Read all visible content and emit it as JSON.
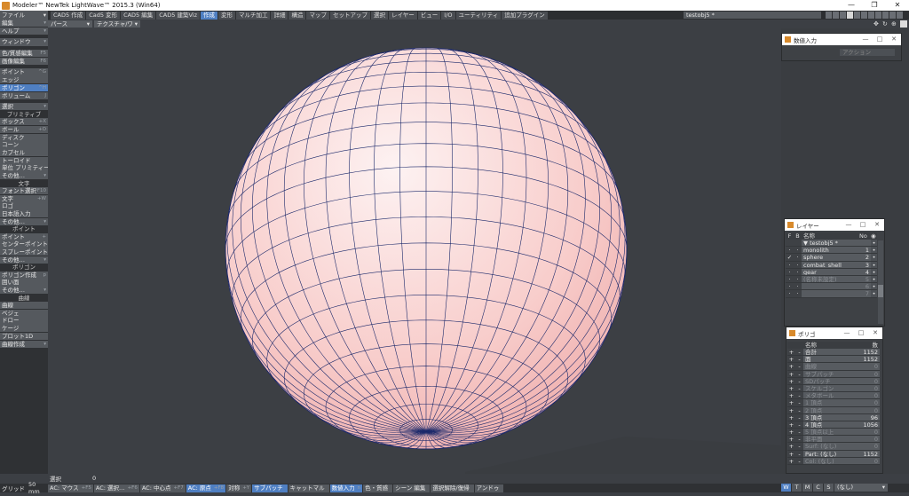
{
  "window": {
    "title": "Modeler™ NewTek LightWave™ 2015.3 (Win64)",
    "controls": [
      "—",
      "❐",
      "✕"
    ]
  },
  "menu": {
    "file": "ファイル",
    "tabs": [
      {
        "label": "CAD5 作成",
        "active": false
      },
      {
        "label": "Cad5 変形",
        "active": false
      },
      {
        "label": "CAD5 編集",
        "active": false
      },
      {
        "label": "CAD5 建築Viz",
        "active": false
      },
      {
        "label": "作成",
        "active": true
      },
      {
        "label": "変形",
        "active": false
      },
      {
        "label": "マルチ加工",
        "active": false
      },
      {
        "label": "詳細",
        "active": false
      },
      {
        "label": "構造",
        "active": false
      },
      {
        "label": "マップ",
        "active": false
      },
      {
        "label": "セットアップ",
        "active": false
      },
      {
        "label": "選択",
        "active": false
      },
      {
        "label": "レイヤー",
        "active": false
      },
      {
        "label": "ビュー",
        "active": false
      },
      {
        "label": "I/O",
        "active": false
      },
      {
        "label": "ユーティリティ",
        "active": false
      },
      {
        "label": "追加プラグイン",
        "active": false
      }
    ],
    "object_combo": "testobj5 *"
  },
  "viewport": {
    "view_combo": "パース",
    "shade_combo": "テクスチャ/ワイヤー",
    "sphere_fill": "#f7c6c4",
    "wire_color": "#1d2a6b"
  },
  "leftbar": {
    "groups": [
      {
        "items": [
          {
            "label": "編集",
            "key": "▾"
          },
          {
            "label": "ヘルプ",
            "key": "▾"
          }
        ]
      },
      {
        "items": [
          {
            "label": "ウィンドウ",
            "key": "▾"
          }
        ]
      },
      {
        "items": [
          {
            "label": "色/質感編集",
            "key": "F5"
          },
          {
            "label": "画像編集",
            "key": "F6"
          }
        ]
      },
      {
        "items": [
          {
            "label": "ポイント",
            "key": "^G"
          },
          {
            "label": "エッジ",
            "key": ""
          },
          {
            "label": "ポリゴン",
            "key": "^H",
            "active": true
          },
          {
            "label": "ボリューム",
            "key": "J"
          }
        ]
      },
      {
        "items": [
          {
            "label": "選択",
            "key": "▾"
          }
        ]
      },
      {
        "head": "プリミティブ",
        "items": [
          {
            "label": "ボックス",
            "key": "+X"
          },
          {
            "label": "ボール",
            "key": "+O"
          },
          {
            "label": "ディスク",
            "key": ""
          },
          {
            "label": "コーン",
            "key": ""
          },
          {
            "label": "カプセル",
            "key": ""
          },
          {
            "label": "トーロイド",
            "key": ""
          },
          {
            "label": "単位 プリミティー",
            "key": "▾"
          },
          {
            "label": "その他…",
            "key": "▾"
          }
        ]
      },
      {
        "head": "文字",
        "items": [
          {
            "label": "フォント選択",
            "key": "F10"
          },
          {
            "label": "文字",
            "key": "+W"
          },
          {
            "label": "ロゴ",
            "key": ""
          },
          {
            "label": "日本語入力",
            "key": ""
          },
          {
            "label": "その他…",
            "key": "▾"
          }
        ]
      },
      {
        "head": "ポイント",
        "items": [
          {
            "label": "ポイント",
            "key": "+"
          },
          {
            "label": "センターポイント追加",
            "key": ""
          },
          {
            "label": "スプレーポイント",
            "key": ""
          },
          {
            "label": "その他…",
            "key": "▾"
          }
        ]
      },
      {
        "head": "ポリゴン",
        "items": [
          {
            "label": "ポリゴン作成",
            "key": "p"
          },
          {
            "label": "囲い面",
            "key": ""
          },
          {
            "label": "その他…",
            "key": "▾"
          }
        ]
      },
      {
        "head": "曲線",
        "items": [
          {
            "label": "曲線",
            "key": ""
          },
          {
            "label": "ベジェ",
            "key": ""
          },
          {
            "label": "ドロー",
            "key": ""
          },
          {
            "label": "ケージ",
            "key": ""
          },
          {
            "label": "プロット1D",
            "key": ""
          },
          {
            "label": "曲線作成",
            "key": "▾"
          }
        ]
      }
    ]
  },
  "numeric_panel": {
    "title": "数値入力",
    "combo": "アクション"
  },
  "layers_panel": {
    "title": "レイヤー",
    "col_f": "F",
    "col_b": "B",
    "col_name": "名称",
    "col_no": "No",
    "rows": [
      {
        "name": "▼ testobj5 *",
        "no": "",
        "f": "",
        "b": "",
        "dim": false
      },
      {
        "name": "monolith",
        "no": "1",
        "f": "·",
        "b": "·",
        "dim": false
      },
      {
        "name": "sphere",
        "no": "2",
        "f": "✓",
        "b": "·",
        "dim": false
      },
      {
        "name": "combat_shell",
        "no": "3",
        "f": "·",
        "b": "·",
        "dim": false
      },
      {
        "name": "gear",
        "no": "4",
        "f": "·",
        "b": "·",
        "dim": false
      },
      {
        "name": "(名称未設定)",
        "no": "5",
        "f": "·",
        "b": "·",
        "dim": true
      },
      {
        "name": "",
        "no": "6",
        "f": "·",
        "b": "·",
        "dim": true
      },
      {
        "name": "",
        "no": "7",
        "f": "·",
        "b": "·",
        "dim": true
      }
    ]
  },
  "poly_panel": {
    "title": "ポリゴ",
    "col_name": "名称",
    "col_count": "数",
    "rows": [
      {
        "name": "合計",
        "count": "1152",
        "dim": false
      },
      {
        "name": "面",
        "count": "1152",
        "dim": false
      },
      {
        "name": "曲線",
        "count": "0",
        "dim": true
      },
      {
        "name": "サブパッチ",
        "count": "0",
        "dim": true
      },
      {
        "name": "SDパッチ",
        "count": "0",
        "dim": true
      },
      {
        "name": "スケルゴン",
        "count": "0",
        "dim": true
      },
      {
        "name": "メタボール",
        "count": "0",
        "dim": true
      },
      {
        "name": "1 頂点",
        "count": "0",
        "dim": true
      },
      {
        "name": "2 頂点",
        "count": "0",
        "dim": true
      },
      {
        "name": "3 頂点",
        "count": "96",
        "dim": false
      },
      {
        "name": "4 頂点",
        "count": "1056",
        "dim": false
      },
      {
        "name": "5 頂点以上",
        "count": "0",
        "dim": true
      },
      {
        "name": "非平面",
        "count": "0",
        "dim": true
      },
      {
        "name": "Surf: (なし)",
        "count": "0",
        "dim": true
      },
      {
        "name": "Part: (なし)",
        "count": "1152",
        "dim": false
      },
      {
        "name": "Col: (なし)",
        "count": "0",
        "dim": true
      }
    ]
  },
  "status": {
    "select_label": "選択",
    "select_count": "0",
    "grid_label": "グリッド",
    "grid_value": "50 mm",
    "buttons": [
      {
        "label": "AC: マウス",
        "key": "+F5",
        "hl": false
      },
      {
        "label": "AC: 選択…",
        "key": "+F6",
        "hl": false
      },
      {
        "label": "AC: 中心点",
        "key": "+F7",
        "hl": false
      },
      {
        "label": "AC: 原点",
        "key": "+F8",
        "hl": true
      },
      {
        "label": "対称",
        "key": "+Y",
        "hl": false
      },
      {
        "label": "サブパッチ",
        "key": "",
        "hl": true
      },
      {
        "label": "キャットマル",
        "key": "",
        "hl": false
      },
      {
        "label": "数値入力",
        "key": "n",
        "hl": true
      },
      {
        "label": "色・質感",
        "key": "",
        "hl": false
      },
      {
        "label": "シーン 編集",
        "key": "",
        "hl": false
      },
      {
        "label": "選択解除/復帰",
        "key": "",
        "hl": false
      },
      {
        "label": "アンドゥ",
        "key": "",
        "hl": false
      }
    ],
    "modes": [
      {
        "label": "W",
        "hl": true
      },
      {
        "label": "T",
        "hl": false
      },
      {
        "label": "M",
        "hl": false
      },
      {
        "label": "C",
        "hl": false
      },
      {
        "label": "S",
        "hl": false
      }
    ],
    "none_combo": "(なし)"
  }
}
